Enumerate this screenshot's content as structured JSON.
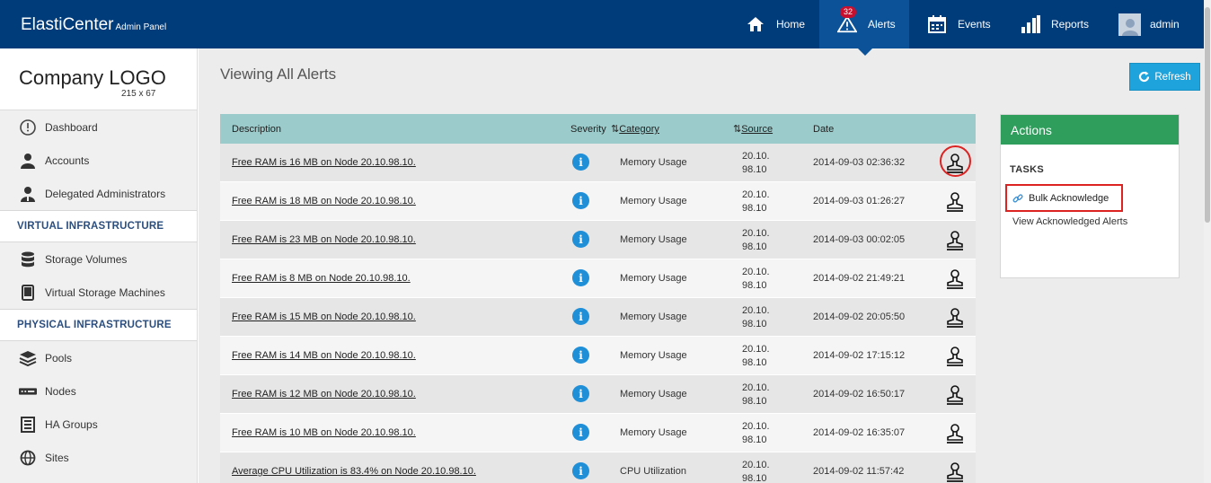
{
  "app": {
    "name": "ElastiCenter",
    "subtitle": "Admin Panel"
  },
  "nav": {
    "home": "Home",
    "alerts": "Alerts",
    "alerts_badge": "32",
    "events": "Events",
    "reports": "Reports",
    "user": "admin"
  },
  "logo": {
    "text": "Company LOGO",
    "size": "215 x 67"
  },
  "sidebar": {
    "dashboard": "Dashboard",
    "accounts": "Accounts",
    "delegated": "Delegated Administrators",
    "virtual_head": "VIRTUAL INFRASTRUCTURE",
    "storage_volumes": "Storage Volumes",
    "vsm": "Virtual Storage Machines",
    "physical_head": "PHYSICAL INFRASTRUCTURE",
    "pools": "Pools",
    "nodes": "Nodes",
    "ha_groups": "HA Groups",
    "sites": "Sites"
  },
  "page": {
    "title": "Viewing All Alerts",
    "refresh": "Refresh"
  },
  "table": {
    "headers": {
      "description": "Description",
      "severity": "Severity",
      "category": "Category",
      "source": "Source",
      "date": "Date"
    },
    "rows": [
      {
        "description": "Free RAM is 16 MB on Node 20.10.98.10.",
        "category": "Memory Usage",
        "source": "20.10.98.10",
        "date": "2014-09-03 02:36:32"
      },
      {
        "description": "Free RAM is 18 MB on Node 20.10.98.10.",
        "category": "Memory Usage",
        "source": "20.10.98.10",
        "date": "2014-09-03 01:26:27"
      },
      {
        "description": "Free RAM is 23 MB on Node 20.10.98.10.",
        "category": "Memory Usage",
        "source": "20.10.98.10",
        "date": "2014-09-03 00:02:05"
      },
      {
        "description": "Free RAM is 8 MB on Node 20.10.98.10.",
        "category": "Memory Usage",
        "source": "20.10.98.10",
        "date": "2014-09-02 21:49:21"
      },
      {
        "description": "Free RAM is 15 MB on Node 20.10.98.10.",
        "category": "Memory Usage",
        "source": "20.10.98.10",
        "date": "2014-09-02 20:05:50"
      },
      {
        "description": "Free RAM is 14 MB on Node 20.10.98.10.",
        "category": "Memory Usage",
        "source": "20.10.98.10",
        "date": "2014-09-02 17:15:12"
      },
      {
        "description": "Free RAM is 12 MB on Node 20.10.98.10.",
        "category": "Memory Usage",
        "source": "20.10.98.10",
        "date": "2014-09-02 16:50:17"
      },
      {
        "description": "Free RAM is 10 MB on Node 20.10.98.10.",
        "category": "Memory Usage",
        "source": "20.10.98.10",
        "date": "2014-09-02 16:35:07"
      },
      {
        "description": "Average CPU Utilization is 83.4% on Node 20.10.98.10.",
        "category": "CPU Utilization",
        "source": "20.10.98.10",
        "date": "2014-09-02 11:57:42"
      }
    ]
  },
  "actions": {
    "title": "Actions",
    "tasks": "TASKS",
    "bulk": "Bulk Acknowledge",
    "view": "View Acknowledged Alerts"
  },
  "colors": {
    "topbar": "#003b7a",
    "active_nav": "#0b5298",
    "table_header": "#9ccbcb",
    "actions_header": "#2f9d5b",
    "refresh": "#1ea3dd",
    "highlight": "#dd2222"
  }
}
